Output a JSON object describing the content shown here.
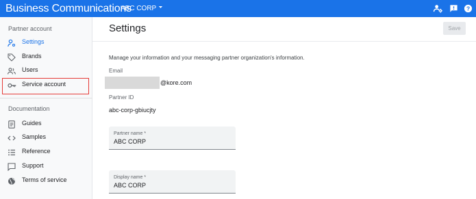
{
  "header": {
    "app_title": "Business Communications",
    "org_name": "ABC CORP",
    "icons": [
      "manage-account-icon",
      "feedback-icon",
      "help-icon"
    ]
  },
  "sidebar": {
    "partner_section": "Partner account",
    "partner_items": [
      {
        "label": "Settings",
        "icon": "settings-account-icon",
        "active": true
      },
      {
        "label": "Brands",
        "icon": "tag-icon"
      },
      {
        "label": "Users",
        "icon": "users-icon"
      },
      {
        "label": "Service account",
        "icon": "key-icon"
      }
    ],
    "docs_section": "Documentation",
    "docs_items": [
      {
        "label": "Guides",
        "icon": "document-icon"
      },
      {
        "label": "Samples",
        "icon": "code-icon"
      },
      {
        "label": "Reference",
        "icon": "list-icon"
      },
      {
        "label": "Support",
        "icon": "chat-icon"
      },
      {
        "label": "Terms of service",
        "icon": "globe-icon"
      }
    ]
  },
  "main": {
    "title": "Settings",
    "save_label": "Save",
    "description": "Manage your information and your messaging partner organization's information.",
    "email_label": "Email",
    "email_suffix": "@kore.com",
    "partner_id_label": "Partner ID",
    "partner_id_value": "abc-corp-gbiucjty",
    "partner_name_label": "Partner name *",
    "partner_name_value": "ABC CORP",
    "display_name_label": "Display name *",
    "display_name_value": "ABC CORP"
  },
  "colors": {
    "accent": "#1a73e8",
    "highlight": "#e53935"
  }
}
